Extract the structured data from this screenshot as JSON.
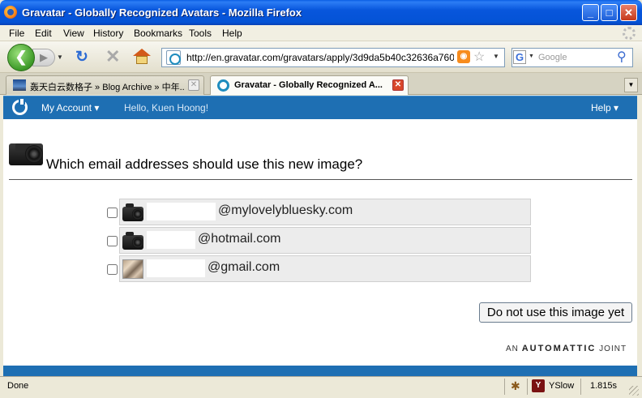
{
  "window": {
    "title": "Gravatar - Globally Recognized Avatars - Mozilla Firefox",
    "controls": {
      "minimize": "_",
      "maximize": "□",
      "close": "✕"
    }
  },
  "menu": [
    "File",
    "Edit",
    "View",
    "History",
    "Bookmarks",
    "Tools",
    "Help"
  ],
  "navbar": {
    "url": "http://en.gravatar.com/gravatars/apply/3d9da5b40c32636a7600ac",
    "search_placeholder": "Google",
    "icons": [
      "back-icon",
      "forward-icon",
      "reload-icon",
      "stop-icon",
      "home-icon",
      "rss-icon",
      "star-icon",
      "google-icon",
      "magnifier-icon"
    ]
  },
  "tabs": [
    {
      "label": "轰天白云数格子 » Blog Archive » 中年...",
      "active": false
    },
    {
      "label": "Gravatar - Globally Recognized A...",
      "active": true
    }
  ],
  "gravatar_bar": {
    "my_account": "My Account",
    "hello": "Hello, Kuen Hoong!",
    "help": "Help",
    "color": "#1e6fb3"
  },
  "page": {
    "heading": "Which email addresses should use this new image?",
    "emails": [
      {
        "suffix": "@mylovelybluesky.com",
        "checked": false,
        "avatar": "camera"
      },
      {
        "suffix": "@hotmail.com",
        "checked": false,
        "avatar": "camera"
      },
      {
        "suffix": "@gmail.com",
        "checked": false,
        "avatar": "photo"
      }
    ],
    "no_image_button": "Do not use this image yet",
    "footer": {
      "an": "AN",
      "brand": "AUTOMATTIC",
      "joint": "JOINT"
    }
  },
  "status": {
    "text": "Done",
    "yslow": "YSlow",
    "time": "1.815s"
  }
}
